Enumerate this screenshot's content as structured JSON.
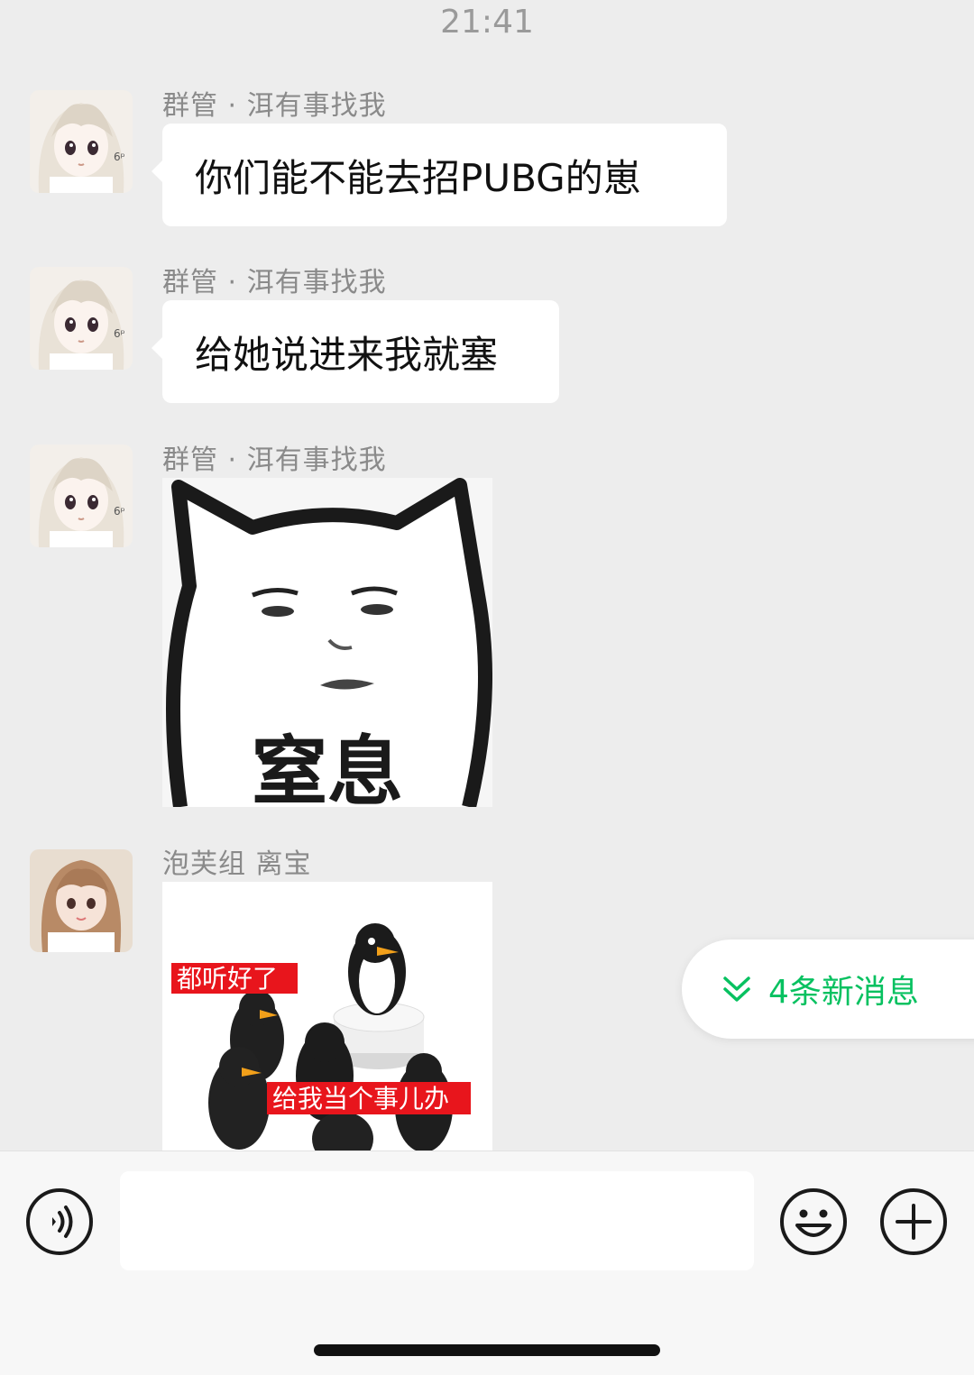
{
  "status": {
    "time": "21:41"
  },
  "messages": [
    {
      "sender": "群管 · 洱有事找我",
      "text": "你们能不能去招PUBG的崽",
      "avatar_icon": "anime-girl-avatar-icon"
    },
    {
      "sender": "群管 · 洱有事找我",
      "text": "给她说进来我就塞",
      "avatar_icon": "anime-girl-avatar-icon"
    },
    {
      "sender": "群管 · 洱有事找我",
      "sticker_caption": "窒息",
      "avatar_icon": "anime-girl-avatar-icon"
    },
    {
      "sender": "泡芙组 离宝",
      "sticker_caption_top": "都听好了",
      "sticker_caption_bottom": "给我当个事儿办",
      "avatar_icon": "girl-photo-avatar-icon"
    }
  ],
  "new_messages": {
    "label": "4条新消息"
  },
  "input": {
    "value": "",
    "placeholder": ""
  },
  "colors": {
    "accent": "#07c160",
    "background": "#ededed",
    "bubble": "#ffffff"
  }
}
